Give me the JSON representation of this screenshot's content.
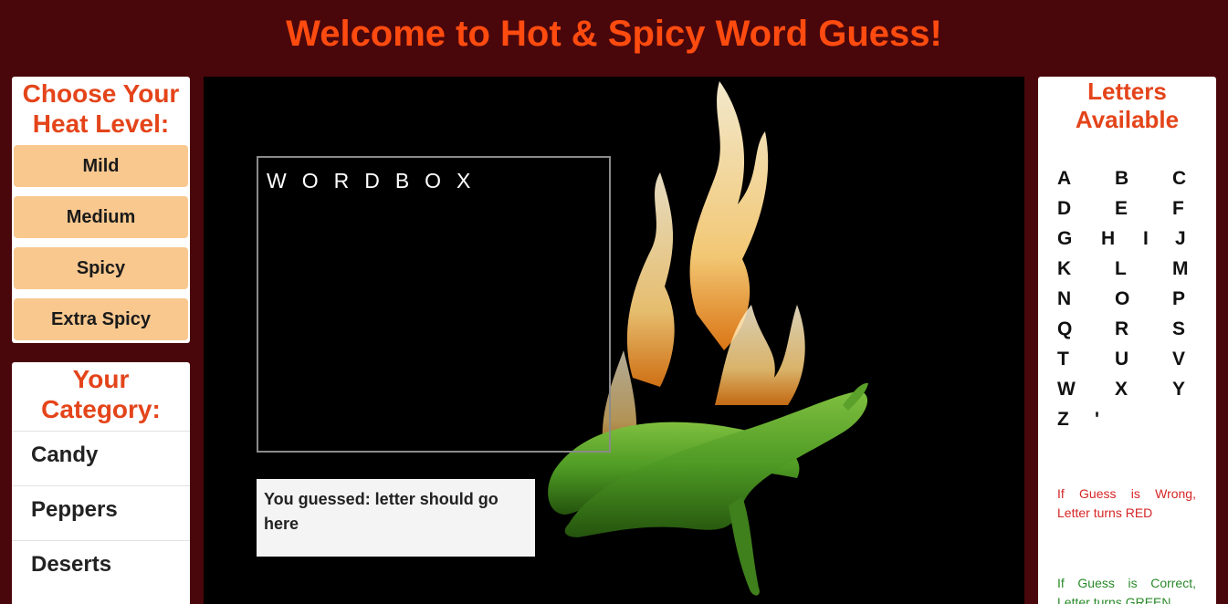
{
  "header": {
    "title": "Welcome to Hot & Spicy Word Guess!"
  },
  "heat": {
    "heading": "Choose Your Heat Level:",
    "levels": [
      "Mild",
      "Medium",
      "Spicy",
      "Extra Spicy"
    ]
  },
  "category": {
    "heading": "Your Category:",
    "items": [
      "Candy",
      "Peppers",
      "Deserts"
    ]
  },
  "wordbox": {
    "label": "WORDBOX"
  },
  "guess": {
    "text": "You guessed: letter should go here"
  },
  "letters": {
    "heading": "Letters Available",
    "items": [
      "A",
      "B",
      "C",
      "D",
      "E",
      "F",
      "G",
      "H",
      "I",
      "J",
      "K",
      "L",
      "M",
      "N",
      "O",
      "P",
      "Q",
      "R",
      "S",
      "T",
      "U",
      "V",
      "W",
      "X",
      "Y",
      "Z",
      "'"
    ]
  },
  "hints": {
    "wrong": "If Guess is Wrong, Letter turns RED",
    "correct": "If Guess is Correct, Letter turns GREEN"
  },
  "colors": {
    "background": "#4a070b",
    "title": "#ff4b0f",
    "heading": "#e4441a",
    "heat_button": "#f8c88f",
    "wrong": "#d62626",
    "correct": "#2a8a2a"
  },
  "stage": {
    "image": "flaming-green-peppers"
  }
}
